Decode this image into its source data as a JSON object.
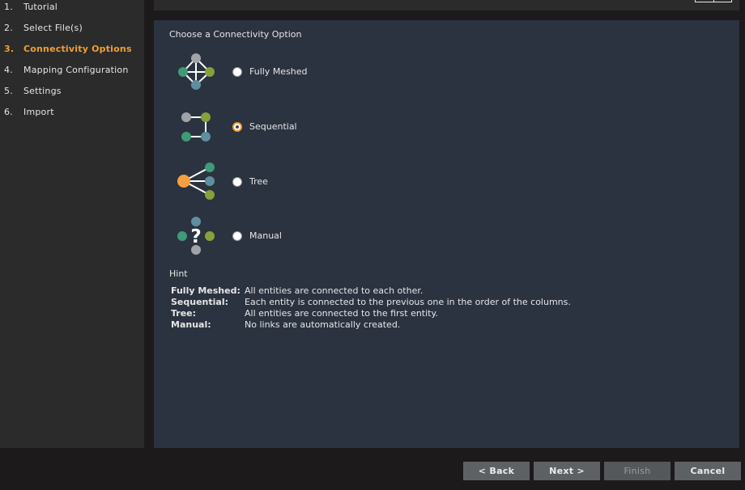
{
  "steps": [
    {
      "num": "1.",
      "label": "Tutorial",
      "active": false
    },
    {
      "num": "2.",
      "label": "Select File(s)",
      "active": false
    },
    {
      "num": "3.",
      "label": "Connectivity Options",
      "active": true
    },
    {
      "num": "4.",
      "label": "Mapping Configuration",
      "active": false
    },
    {
      "num": "5.",
      "label": "Settings",
      "active": false
    },
    {
      "num": "6.",
      "label": "Import",
      "active": false
    }
  ],
  "panel": {
    "title": "Choose a Connectivity Option",
    "options": [
      {
        "label": "Fully Meshed",
        "icon": "fully-meshed-icon",
        "selected": false
      },
      {
        "label": "Sequential",
        "icon": "sequential-icon",
        "selected": true
      },
      {
        "label": "Tree",
        "icon": "tree-icon",
        "selected": false
      },
      {
        "label": "Manual",
        "icon": "manual-icon",
        "selected": false
      }
    ],
    "hint_title": "Hint",
    "hints": [
      {
        "term": "Fully Meshed:",
        "desc": "All entities are connected to each other."
      },
      {
        "term": "Sequential:",
        "desc": "Each entity is connected to the previous one in the order of the columns."
      },
      {
        "term": "Tree:",
        "desc": "All entities are connected to the first entity."
      },
      {
        "term": "Manual:",
        "desc": "No links are automatically created."
      }
    ]
  },
  "buttons": {
    "back": "< Back",
    "next": "Next >",
    "finish": "Finish",
    "cancel": "Cancel"
  },
  "colors": {
    "accent": "#f0a030",
    "node_gray": "#a0a3a8",
    "node_green": "#3f9a78",
    "node_olive": "#86a03a",
    "node_blue": "#5e8fa0",
    "node_orange": "#f5a040"
  }
}
